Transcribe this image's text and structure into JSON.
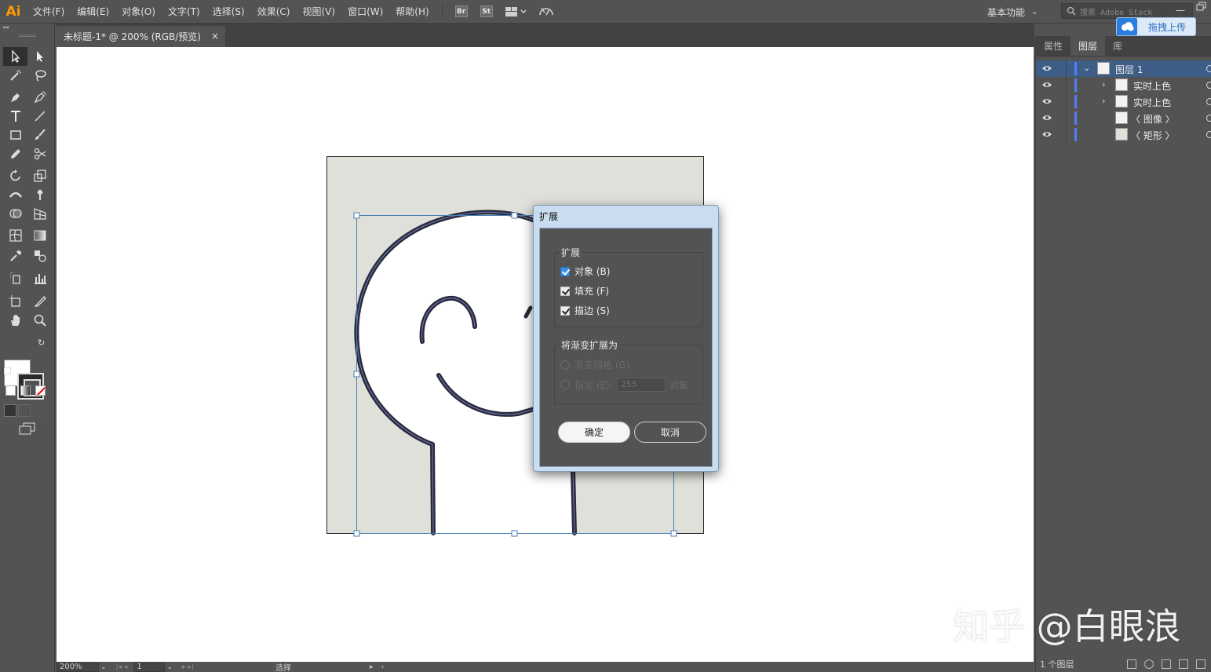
{
  "app": {
    "logo": "Ai",
    "menu": [
      "文件(F)",
      "编辑(E)",
      "对象(O)",
      "文字(T)",
      "选择(S)",
      "效果(C)",
      "视图(V)",
      "窗口(W)",
      "帮助(H)"
    ],
    "toolbar_icons": [
      "bridge-icon",
      "stock-icon",
      "arrange-documents-icon",
      "gpu-performance-icon"
    ],
    "toolbar_labels": {
      "bridge": "Br",
      "stock": "St"
    },
    "workspace": "基本功能",
    "search_placeholder": "搜索 Adobe Stock",
    "upload_button": "拖拽上传"
  },
  "document": {
    "tab_title": "未标题-1* @ 200% (RGB/预览)",
    "close": "×"
  },
  "status": {
    "zoom": "200%",
    "page": "1",
    "tool": "选择"
  },
  "panels": {
    "tabs": [
      "属性",
      "图层",
      "库"
    ],
    "active_tab": "图层",
    "layers": [
      {
        "name": "图层 1",
        "level": 0,
        "expanded": true,
        "selected": true
      },
      {
        "name": "实时上色",
        "level": 1,
        "expanded": false,
        "selected": false
      },
      {
        "name": "实时上色",
        "level": 1,
        "expanded": false,
        "selected": false
      },
      {
        "name": "〈 图像 〉",
        "level": 1,
        "expanded": null,
        "selected": false
      },
      {
        "name": "〈 矩形 〉",
        "level": 1,
        "expanded": null,
        "selected": false
      }
    ],
    "footer": "1 个图层"
  },
  "dialog": {
    "title": "扩展",
    "expand_group": "扩展",
    "options": [
      {
        "label": "对象 (B)",
        "checked": true
      },
      {
        "label": "填充 (F)",
        "checked": true
      },
      {
        "label": "描边 (S)",
        "checked": true
      }
    ],
    "gradient_group": "将渐变扩展为",
    "gradient_mesh": "渐变网格 (G)",
    "specify": "指定 (E):",
    "specify_value": "255",
    "specify_unit": "对象",
    "ok": "确定",
    "cancel": "取消"
  },
  "colors": {
    "accent": "#3e5d87",
    "logo": "#ff9a00",
    "dialog_frame": "#c9dcf0",
    "artboard_bg": "#e0e0da",
    "selection": "#4a7fb5"
  },
  "watermark": "知乎 @白眼浪"
}
